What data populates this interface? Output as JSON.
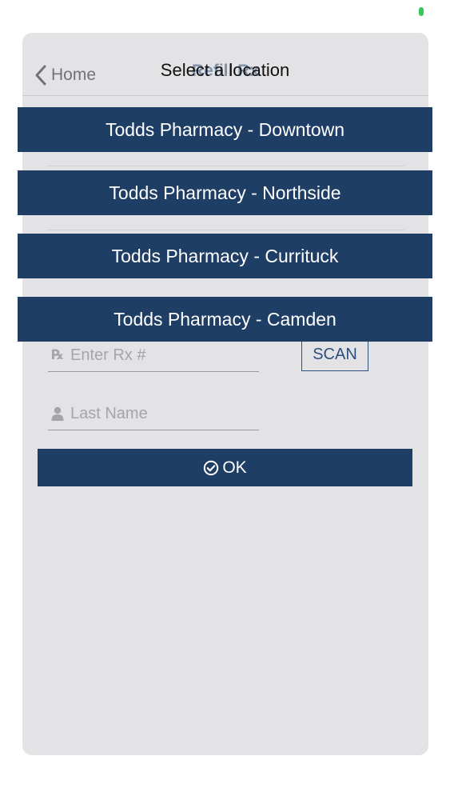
{
  "status": {
    "indicator_color": "#35c759"
  },
  "nav": {
    "back_label": "Home",
    "title": "Refill Rx"
  },
  "form": {
    "rx_icon": "Rx-icon",
    "rx_placeholder": "Enter Rx #",
    "scan_label": "SCAN",
    "name_placeholder": "Last Name",
    "ok_label": "OK"
  },
  "location_picker": {
    "title": "Select a location",
    "options": [
      {
        "label": "Todds Pharmacy - Downtown"
      },
      {
        "label": "Todds Pharmacy - Northside"
      },
      {
        "label": "Todds Pharmacy - Currituck"
      },
      {
        "label": "Todds Pharmacy - Camden"
      }
    ]
  },
  "colors": {
    "primary": "#1e3e66",
    "sheet_bg": "#e3e3e6",
    "muted_text": "#a4a4a9"
  }
}
